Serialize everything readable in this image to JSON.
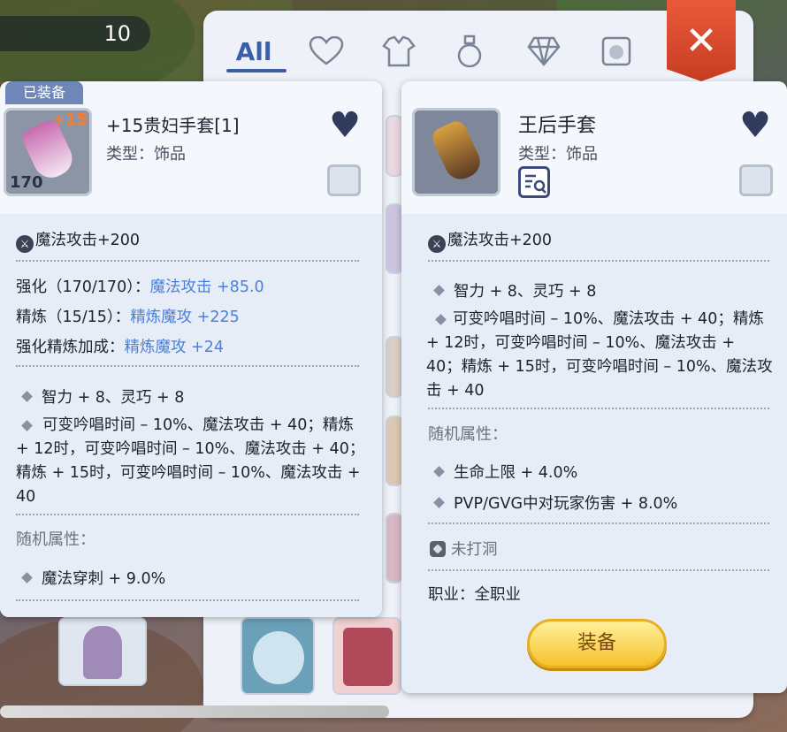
{
  "counter": {
    "value": "10"
  },
  "tabs": [
    {
      "label": "All",
      "icon": "all"
    },
    {
      "label": "",
      "icon": "heart-outline-icon"
    },
    {
      "label": "",
      "icon": "armor-icon"
    },
    {
      "label": "",
      "icon": "potion-bottle-icon"
    },
    {
      "label": "",
      "icon": "diamond-gem-icon"
    },
    {
      "label": "",
      "icon": "card-pet-icon"
    }
  ],
  "close_label": "✕",
  "left_card": {
    "badge": "已装备",
    "title": "+15贵妇手套[1]",
    "type": "类型：饰品",
    "refine_badge": "+15",
    "level_badge": "170",
    "base_attr": "魔法攻击+200",
    "enhance_label": "强化（170/170）：",
    "enhance_value": "魔法攻击 +85.0",
    "refine_label": "精炼（15/15）：",
    "refine_value": "精炼魔攻 +225",
    "bonus_label": "强化精炼加成：",
    "bonus_value": "精炼魔攻 +24",
    "effect1": "智力 + 8、灵巧 + 8",
    "effect2": "可变吟唱时间 – 10%、魔法攻击 + 40；精炼 + 12时，可变吟唱时间 – 10%、魔法攻击 + 40；精炼 + 15时，可变吟唱时间 – 10%、魔法攻击 + 40",
    "random_heading": "随机属性：",
    "random1": "魔法穿刺 + 9.0%"
  },
  "right_card": {
    "title": "王后手套",
    "type": "类型：饰品",
    "base_attr": "魔法攻击+200",
    "effect1": "智力 + 8、灵巧 + 8",
    "effect2": "可变吟唱时间 – 10%、魔法攻击 + 40；精炼 + 12时，可变吟唱时间 – 10%、魔法攻击 + 40；精炼 + 15时，可变吟唱时间 – 10%、魔法攻击 + 40",
    "random_heading": "随机属性：",
    "random1": "生命上限 + 4.0%",
    "random2": "PVP/GVG中对玩家伤害 + 8.0%",
    "socket": "未打洞",
    "job": "职业：全职业"
  },
  "equip_button": "装备",
  "colors": {
    "accent": "#3a5ea8",
    "blue_value": "#4c7fd8",
    "close_red": "#d84a2e",
    "button_gold": "#f5c22e"
  }
}
